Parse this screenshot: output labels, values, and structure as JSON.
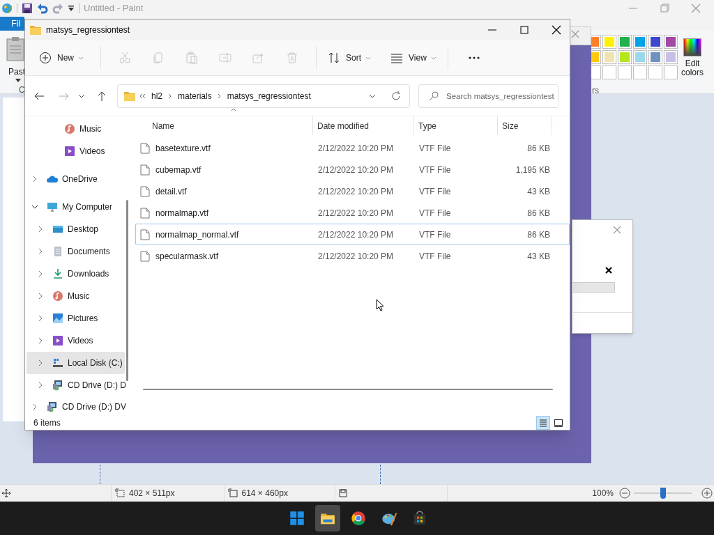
{
  "paint": {
    "title": "Untitled - Paint",
    "file_tab": "Fil",
    "paste_label": "Past",
    "clipboard_label": "C",
    "colors_label": "rs",
    "edit_colors": "Edit colors",
    "palette": [
      {
        "color": "#ff7f27"
      },
      {
        "color": "#fff200"
      },
      {
        "color": "#22b14c"
      },
      {
        "color": "#00a2e8"
      },
      {
        "color": "#3f48cc"
      },
      {
        "color": "#a349a4"
      },
      {
        "color": "#ffc90e"
      },
      {
        "color": "#efe4b0"
      },
      {
        "color": "#b5e61d"
      },
      {
        "color": "#99d9ea"
      },
      {
        "color": "#7092be"
      },
      {
        "color": "#c8bfe7"
      },
      {
        "color": "#ffffff"
      },
      {
        "color": "#ffffff"
      },
      {
        "color": "#ffffff"
      },
      {
        "color": "#ffffff"
      },
      {
        "color": "#ffffff"
      },
      {
        "color": "#ffffff"
      }
    ],
    "status": {
      "selection_size": "402 × 511px",
      "canvas_size": "614 × 460px",
      "zoom": "100%"
    },
    "zoom_slider": {
      "level": 0.5
    }
  },
  "explorer": {
    "title": "matsys_regressiontest",
    "toolbar": [
      {
        "kind": "new",
        "label": "New",
        "disabled": false
      },
      {
        "kind": "cut",
        "disabled": true
      },
      {
        "kind": "copy",
        "disabled": true
      },
      {
        "kind": "paste",
        "disabled": true
      },
      {
        "kind": "rename",
        "disabled": true
      },
      {
        "kind": "share",
        "disabled": true
      },
      {
        "kind": "delete",
        "disabled": true
      },
      {
        "kind": "sort",
        "label": "Sort",
        "disabled": false
      },
      {
        "kind": "view",
        "label": "View",
        "disabled": false
      },
      {
        "kind": "more",
        "disabled": false
      }
    ],
    "breadcrumb": [
      "hl2",
      "materials",
      "matsys_regressiontest"
    ],
    "search_placeholder": "Search matsys_regressiontest",
    "nav": [
      {
        "label": "Music",
        "kind": "music",
        "selected": false
      },
      {
        "label": "Videos",
        "kind": "video",
        "selected": false
      },
      {
        "label": "OneDrive",
        "kind": "cloud",
        "expanded": false,
        "selected": false
      },
      {
        "label": "My Computer",
        "kind": "computer",
        "expanded": true,
        "selected": false,
        "children": [
          {
            "label": "Desktop",
            "kind": "desktop",
            "expanded": false,
            "selected": false
          },
          {
            "label": "Documents",
            "kind": "document",
            "expanded": false,
            "selected": false
          },
          {
            "label": "Downloads",
            "kind": "download",
            "expanded": false,
            "selected": false
          },
          {
            "label": "Music",
            "kind": "music",
            "expanded": false,
            "selected": false
          },
          {
            "label": "Pictures",
            "kind": "picture",
            "expanded": false,
            "selected": false
          },
          {
            "label": "Videos",
            "kind": "video",
            "expanded": false,
            "selected": false
          },
          {
            "label": "Local Disk (C:)",
            "kind": "disk",
            "expanded": false,
            "selected": true
          },
          {
            "label": "CD Drive (D:) D",
            "kind": "cd",
            "expanded": false,
            "selected": false
          }
        ]
      },
      {
        "label": "CD Drive (D:) DV",
        "kind": "cd",
        "expanded": false,
        "selected": false
      }
    ],
    "columns": [
      "Name",
      "Date modified",
      "Type",
      "Size"
    ],
    "rows": [
      {
        "name": "basetexture.vtf",
        "date": "2/12/2022 10:20 PM",
        "type": "VTF File",
        "size": "86 KB",
        "hovered": false
      },
      {
        "name": "cubemap.vtf",
        "date": "2/12/2022 10:20 PM",
        "type": "VTF File",
        "size": "1,195 KB",
        "hovered": false
      },
      {
        "name": "detail.vtf",
        "date": "2/12/2022 10:20 PM",
        "type": "VTF File",
        "size": "43 KB",
        "hovered": false
      },
      {
        "name": "normalmap.vtf",
        "date": "2/12/2022 10:20 PM",
        "type": "VTF File",
        "size": "86 KB",
        "hovered": false
      },
      {
        "name": "normalmap_normal.vtf",
        "date": "2/12/2022 10:20 PM",
        "type": "VTF File",
        "size": "86 KB",
        "hovered": true
      },
      {
        "name": "specularmask.vtf",
        "date": "2/12/2022 10:20 PM",
        "type": "VTF File",
        "size": "43 KB",
        "hovered": false
      }
    ],
    "status": "6 items",
    "views": [
      {
        "kind": "details",
        "selected": true
      },
      {
        "kind": "tiles",
        "selected": false
      }
    ]
  },
  "taskbar": [
    {
      "kind": "start",
      "active": false
    },
    {
      "kind": "files",
      "active": true
    },
    {
      "kind": "browser",
      "active": false
    },
    {
      "kind": "paint",
      "active": false
    },
    {
      "kind": "store",
      "active": false
    }
  ]
}
